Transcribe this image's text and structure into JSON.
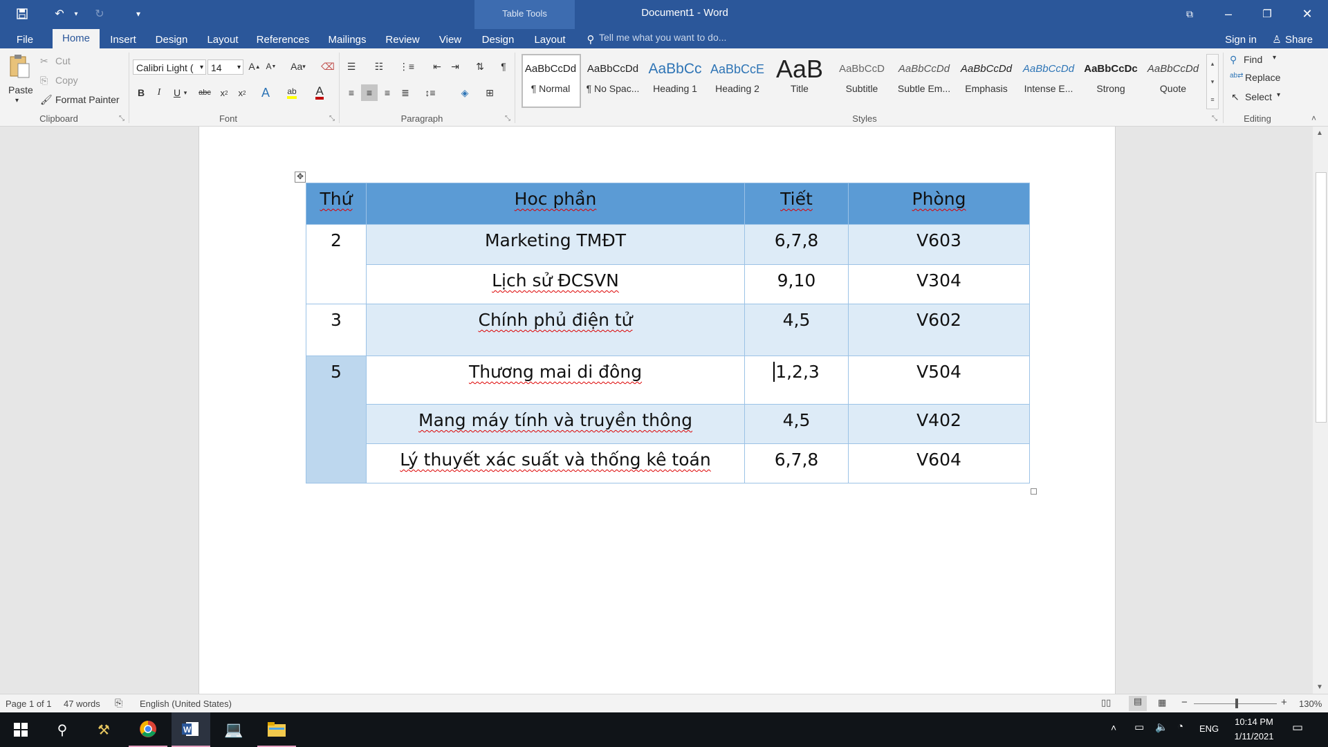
{
  "window": {
    "title": "Document1 - Word",
    "context_tab_group": "Table Tools"
  },
  "tabs": [
    "File",
    "Home",
    "Insert",
    "Design",
    "Layout",
    "References",
    "Mailings",
    "Review",
    "View",
    "Design",
    "Layout"
  ],
  "active_tab": "Home",
  "tell_me_placeholder": "Tell me what you want to do...",
  "account": {
    "sign_in": "Sign in",
    "share": "Share"
  },
  "clipboard": {
    "paste": "Paste",
    "cut": "Cut",
    "copy": "Copy",
    "format_painter": "Format Painter",
    "group": "Clipboard"
  },
  "font": {
    "family": "Calibri Light (",
    "size": "14",
    "case_label": "Aa",
    "group": "Font"
  },
  "paragraph": {
    "group": "Paragraph"
  },
  "styles": {
    "group": "Styles",
    "items": [
      {
        "sample": "AaBbCcDd",
        "name": "¶ Normal"
      },
      {
        "sample": "AaBbCcDd",
        "name": "¶ No Spac..."
      },
      {
        "sample": "AaBbCc",
        "name": "Heading 1"
      },
      {
        "sample": "AaBbCcE",
        "name": "Heading 2"
      },
      {
        "sample": "AaB",
        "name": "Title"
      },
      {
        "sample": "AaBbCcD",
        "name": "Subtitle"
      },
      {
        "sample": "AaBbCcDd",
        "name": "Subtle Em..."
      },
      {
        "sample": "AaBbCcDd",
        "name": "Emphasis"
      },
      {
        "sample": "AaBbCcDd",
        "name": "Intense E..."
      },
      {
        "sample": "AaBbCcDc",
        "name": "Strong"
      },
      {
        "sample": "AaBbCcDd",
        "name": "Quote"
      }
    ]
  },
  "editing": {
    "group": "Editing",
    "find": "Find",
    "replace": "Replace",
    "select": "Select"
  },
  "table": {
    "headers": [
      "Thứ",
      "Hoc phần",
      "Tiết",
      "Phòng"
    ],
    "rows": [
      {
        "day": "2",
        "course": "Marketing TMĐT",
        "period": "6,7,8",
        "room": "V603"
      },
      {
        "day": "",
        "course": "Lịch sử ĐCSVN",
        "period": "9,10",
        "room": "V304"
      },
      {
        "day": "3",
        "course": "Chính phủ điện tử",
        "period": "4,5",
        "room": "V602"
      },
      {
        "day": "5",
        "course": "Thương mai di đông",
        "period": "1,2,3",
        "room": "V504"
      },
      {
        "day": "",
        "course": "Mang máy tính và truyền thông",
        "period": "4,5",
        "room": "V402"
      },
      {
        "day": "",
        "course": "Lý thuyết xác suất và thống kê toán",
        "period": "6,7,8",
        "room": "V604"
      }
    ]
  },
  "status": {
    "page": "Page 1 of 1",
    "words": "47 words",
    "language": "English (United States)",
    "zoom": "130%"
  },
  "taskbar": {
    "time": "10:14 PM",
    "date": "1/11/2021",
    "lang": "ENG"
  },
  "colors": {
    "word_blue": "#2b579a",
    "table_header": "#5b9bd5",
    "table_band": "#ddebf7",
    "table_day": "#bdd7ee"
  }
}
